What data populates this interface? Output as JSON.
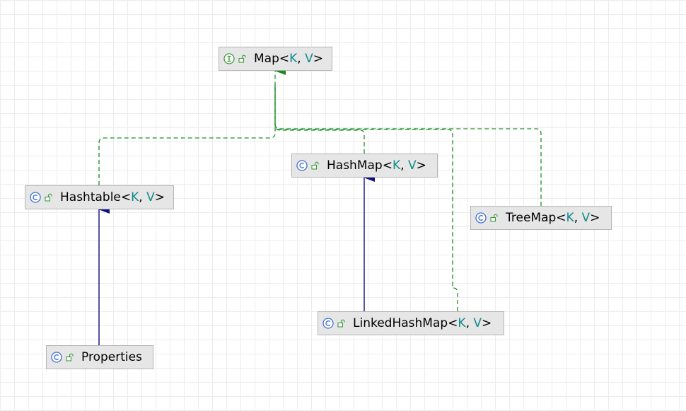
{
  "diagram": {
    "colors": {
      "interface_icon": "#3c9a3c",
      "class_icon": "#3f6ed8",
      "visibility_icon": "#3c9a3c",
      "type_param": "#0f8b8b",
      "realization_edge": "#22902a",
      "extends_edge": "#101080",
      "node_fill": "#e6e6e6",
      "node_border": "#b4b4b4"
    },
    "nodes": {
      "map": {
        "kind": "interface",
        "icon": "interface-icon",
        "name": "Map",
        "open": "<",
        "k": "K",
        "sep": ", ",
        "v": "V",
        "close": ">"
      },
      "hashtable": {
        "kind": "class",
        "icon": "class-icon",
        "name": "Hashtable",
        "open": "<",
        "k": "K",
        "sep": ", ",
        "v": "V",
        "close": ">"
      },
      "hashmap": {
        "kind": "class",
        "icon": "class-icon",
        "name": "HashMap",
        "open": "<",
        "k": "K",
        "sep": ", ",
        "v": "V",
        "close": ">"
      },
      "treemap": {
        "kind": "class",
        "icon": "class-icon",
        "name": "TreeMap",
        "open": "<",
        "k": "K",
        "sep": ", ",
        "v": "V",
        "close": ">"
      },
      "linkedhashmap": {
        "kind": "class",
        "icon": "class-icon",
        "name": "LinkedHashMap",
        "open": "<",
        "k": "K",
        "sep": ", ",
        "v": "V",
        "close": ">"
      },
      "properties": {
        "kind": "class",
        "icon": "class-icon",
        "name": "Properties"
      }
    },
    "edges": [
      {
        "from": "hashtable",
        "to": "map",
        "type": "realization"
      },
      {
        "from": "hashmap",
        "to": "map",
        "type": "realization"
      },
      {
        "from": "linkedhashmap",
        "to": "map",
        "type": "realization"
      },
      {
        "from": "treemap",
        "to": "map",
        "type": "realization"
      },
      {
        "from": "properties",
        "to": "hashtable",
        "type": "extends"
      },
      {
        "from": "linkedhashmap",
        "to": "hashmap",
        "type": "extends"
      }
    ]
  }
}
